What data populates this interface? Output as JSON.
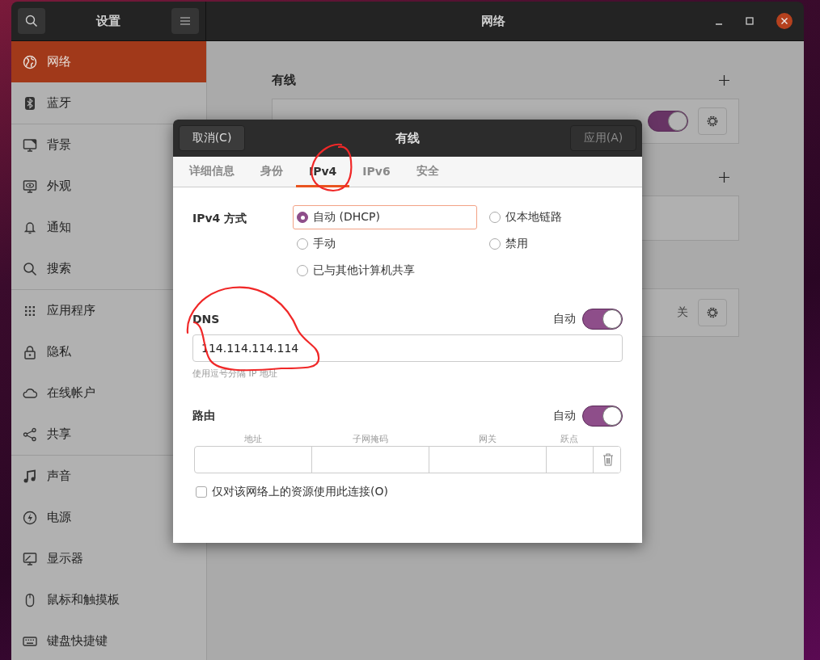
{
  "settings_window": {
    "title": "设置",
    "page_title": "网络"
  },
  "sidebar": {
    "sections": [
      [
        {
          "label": "网络",
          "selected": true
        },
        {
          "label": "蓝牙",
          "selected": false
        }
      ],
      [
        {
          "label": "背景",
          "selected": false
        },
        {
          "label": "外观",
          "selected": false
        },
        {
          "label": "通知",
          "selected": false
        },
        {
          "label": "搜索",
          "selected": false
        }
      ],
      [
        {
          "label": "应用程序",
          "selected": false
        },
        {
          "label": "隐私",
          "selected": false
        },
        {
          "label": "在线帐户",
          "selected": false
        },
        {
          "label": "共享",
          "selected": false
        }
      ],
      [
        {
          "label": "声音",
          "selected": false
        },
        {
          "label": "电源",
          "selected": false
        },
        {
          "label": "显示器",
          "selected": false
        },
        {
          "label": "鼠标和触摸板",
          "selected": false
        },
        {
          "label": "键盘快捷键",
          "selected": false
        }
      ]
    ]
  },
  "network_page": {
    "sections": [
      {
        "heading": "有线",
        "add": true,
        "card": {
          "kind": "toggle",
          "on": true
        }
      },
      {
        "add": true,
        "card": {
          "kind": "empty"
        }
      },
      {
        "add": false,
        "card": {
          "kind": "status",
          "text": "关"
        }
      }
    ]
  },
  "dialog": {
    "cancel": "取消(C)",
    "title": "有线",
    "apply": "应用(A)",
    "apply_disabled": true,
    "tabs": [
      {
        "label": "详细信息",
        "selected": false
      },
      {
        "label": "身份",
        "selected": false
      },
      {
        "label": "IPv4",
        "selected": true
      },
      {
        "label": "IPv6",
        "selected": false
      },
      {
        "label": "安全",
        "selected": false
      }
    ],
    "method": {
      "label": "IPv4 方式",
      "options": [
        {
          "label": "自动 (DHCP)",
          "selected": true
        },
        {
          "label": "仅本地链路",
          "selected": false
        },
        {
          "label": "手动",
          "selected": false
        },
        {
          "label": "禁用",
          "selected": false
        },
        {
          "label": "已与其他计算机共享",
          "selected": false
        }
      ]
    },
    "dns": {
      "label": "DNS",
      "auto_label": "自动",
      "auto": true,
      "value": "114.114.114.114",
      "hint": "使用逗号分隔 IP 地址"
    },
    "routes": {
      "label": "路由",
      "auto_label": "自动",
      "auto": true,
      "columns": [
        "地址",
        "子网掩码",
        "网关",
        "跃点"
      ]
    },
    "only_local": {
      "label": "仅对该网络上的资源使用此连接(O)",
      "checked": false
    }
  }
}
